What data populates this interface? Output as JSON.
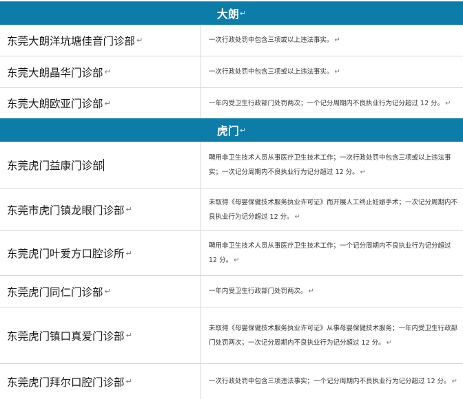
{
  "sections": [
    {
      "title": "大朗",
      "rows": [
        {
          "name": "东莞大朗洋坑塘佳音门诊部",
          "desc": "一次行政处罚中包含三项或以上违法事实。"
        },
        {
          "name": "东莞大朗晶华门诊部",
          "desc": "一次行政处罚中包含三项或以上违法事实。"
        },
        {
          "name": "东莞大朗欧亚门诊部",
          "desc": "一年内受卫生行政部门处罚两次；一个记分周期内不良执业行为记分超过 12 分。"
        }
      ]
    },
    {
      "title": "虎门",
      "rows": [
        {
          "name": "东莞虎门益康门诊部",
          "desc": "聘用非卫生技术人员从事医疗卫生技术工作；一次行政处罚中包含三项或以上违法事实；一次记分周期内不良执业行为记分超过 12 分。"
        },
        {
          "name": "东莞市虎门镇龙眼门诊部",
          "desc": "未取得《母婴保健技术服务执业许可证》而开展人工终止妊娠手术；一次记分周期内不良执业行为记分超过 12 分。"
        },
        {
          "name": "东莞虎门叶爱方口腔诊所",
          "desc": "聘用非卫生技术人员从事医疗卫生技术工作；一个记分周期内不良执业行为记分超过 12 分。"
        },
        {
          "name": "东莞虎门同仁门诊部",
          "desc": "一年内受卫生行政部门处罚两次。"
        },
        {
          "name": "东莞虎门镇口真爱门诊部",
          "desc": "未取得《母婴保健技术服务执业许可证》从事母婴保健技术服务；一年内受卫生行政部门处罚两次；一次记分周期内不良执业行为记分超过 12 分。"
        },
        {
          "name": "东莞虎门拜尔口腔门诊部",
          "desc": "一次行政处罚中包含三项违法事实；一个记分周期内不良执业行为记分超过 12 分。"
        }
      ]
    }
  ],
  "marks": {
    "paragraph": "↵"
  },
  "colors": {
    "header_bg": "#0b7da8",
    "border": "#d9d9d9"
  }
}
